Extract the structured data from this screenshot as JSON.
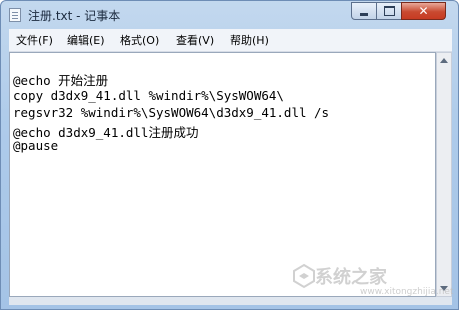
{
  "window": {
    "title": "注册.txt - 记事本",
    "close_glyph": "✕"
  },
  "menu": {
    "items": [
      "文件(F)",
      "编辑(E)",
      "格式(O)",
      "查看(V)",
      "帮助(H)"
    ]
  },
  "document": {
    "lines": [
      "",
      "@echo 开始注册",
      "copy d3dx9_41.dll %windir%\\SysWOW64\\",
      "regsvr32 %windir%\\SysWOW64\\d3dx9_41.dll /s",
      "@echo d3dx9_41.dll注册成功",
      "@pause"
    ]
  },
  "watermark": {
    "text": "系统之家",
    "url": "www.xitongzhijia.net"
  },
  "icons": {
    "app": "notepad-icon",
    "minimize": "minimize-icon",
    "maximize": "maximize-icon",
    "close": "close-icon"
  },
  "colors": {
    "title_bar": "#aecbea",
    "close_button": "#c94a30",
    "editor_bg": "#ffffff",
    "menu_bg": "#f1f4f9"
  }
}
